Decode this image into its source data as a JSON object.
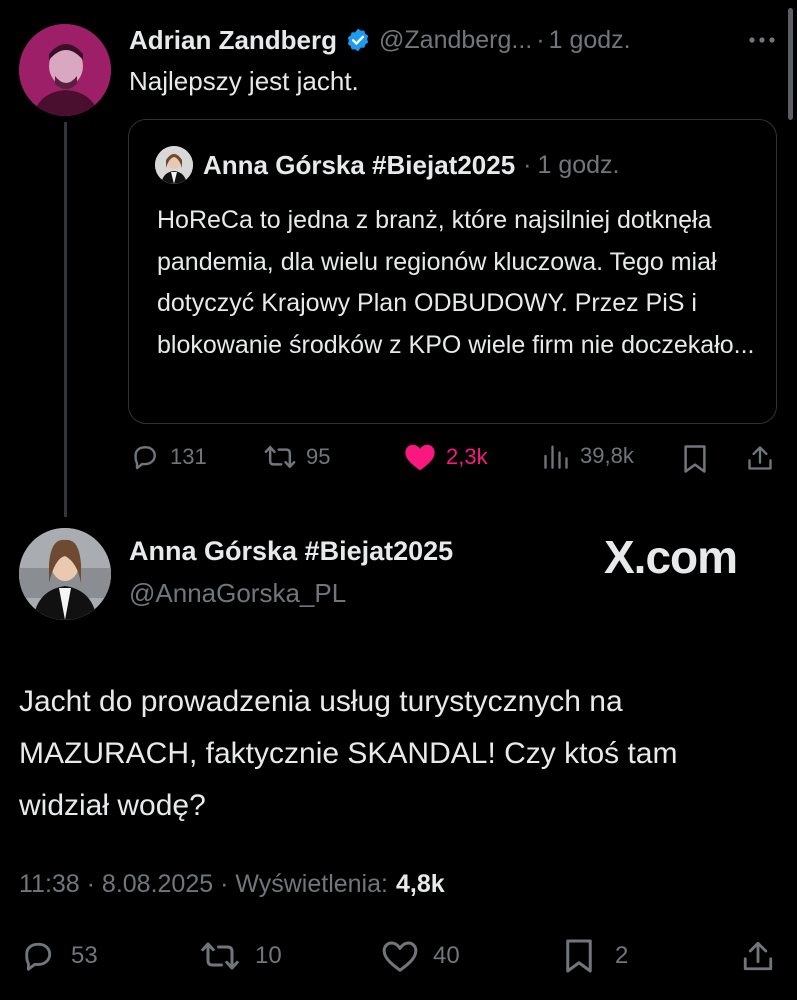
{
  "reply": {
    "name": "Adrian Zandberg",
    "handle": "@Zandberg...",
    "time": "1 godz.",
    "text": "Najlepszy jest jacht.",
    "quoted": {
      "name": "Anna Górska #Biejat2025",
      "time": "1 godz.",
      "text": "HoReCa to jedna z branż, które najsilniej dotknęła pandemia, dla wielu regionów kluczowa. Tego miał dotyczyć Krajowy Plan ODBUDOWY. Przez PiS i blokowanie środków z KPO wiele firm nie doczekało..."
    },
    "stats": {
      "replies": "131",
      "reposts": "95",
      "likes": "2,3k",
      "views": "39,8k"
    }
  },
  "main": {
    "name": "Anna Górska #Biejat2025",
    "handle": "@AnnaGorska_PL",
    "watermark": "X.com",
    "text": "Jacht do prowadzenia usług turystycznych na MAZURACH, faktycznie SKANDAL! Czy ktoś tam widział wodę?",
    "timestamp": "11:38 · 8.08.2025 · Wyświetlenia:",
    "views": "4,8k",
    "stats": {
      "replies": "53",
      "reposts": "10",
      "likes": "40",
      "bookmarks": "2"
    }
  },
  "colors": {
    "background": "#000000",
    "text": "#e7e9ea",
    "muted": "#71767b",
    "verified": "#1d9bf0",
    "like": "#f91880",
    "avatar_primary": "#9c1f67"
  },
  "icons": [
    "more-icon",
    "verified-icon",
    "reply-icon",
    "repost-icon",
    "like-icon",
    "views-icon",
    "bookmark-icon",
    "share-icon"
  ]
}
